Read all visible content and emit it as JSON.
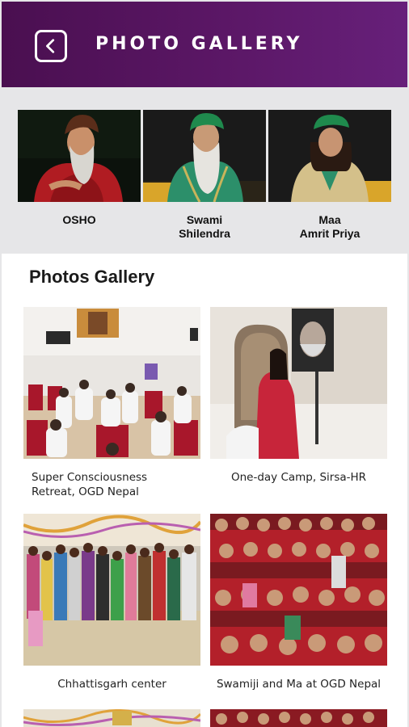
{
  "header": {
    "title": "PHOTO GALLERY"
  },
  "featured": [
    {
      "name": "OSHO"
    },
    {
      "name": "Swami\nShilendra"
    },
    {
      "name": "Maa\nAmrit Priya"
    }
  ],
  "gallery": {
    "title": "Photos Gallery",
    "items": [
      {
        "caption": "Super Consciousness\nRetreat, OGD Nepal"
      },
      {
        "caption": "One-day Camp, Sirsa-HR"
      },
      {
        "caption": "Chhattisgarh center"
      },
      {
        "caption": "Swamiji and Ma at OGD Nepal"
      }
    ]
  },
  "colors": {
    "header": "#5b1766",
    "background": "#e6e6e8",
    "panel": "#ffffff"
  }
}
